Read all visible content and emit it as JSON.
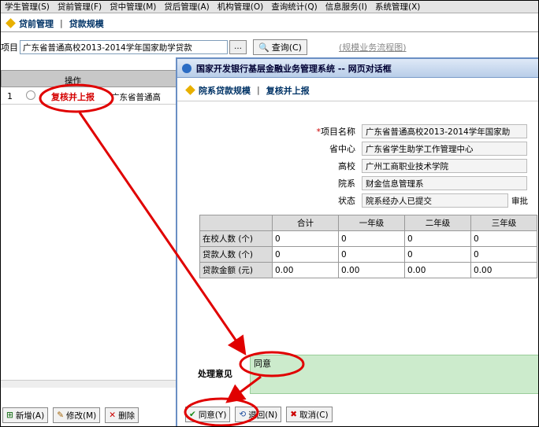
{
  "menu": [
    "学生管理(S)",
    "贷前管理(F)",
    "贷中管理(M)",
    "贷后管理(A)",
    "机构管理(O)",
    "查询统计(Q)",
    "信息服务(I)",
    "系统管理(X)"
  ],
  "tabs": {
    "first": "贷前管理",
    "second": "贷款规模"
  },
  "project": {
    "label": "项目",
    "value": "广东省普通高校2013-2014学年国家助学贷款",
    "query_label": "查询(C)",
    "flow_link": "(规模业务流程图)"
  },
  "grid": {
    "header_op": "操作",
    "row_num": "1",
    "row_action": "复核并上报",
    "row_name": "广东省普通高"
  },
  "bottom_toolbar": {
    "add": "新增(A)",
    "edit": "修改(M)",
    "delete": "删除"
  },
  "dialog": {
    "title": "国家开发银行基层金融业务管理系统 -- 网页对话框",
    "tab1": "院系贷款规模",
    "tab2": "复核并上报",
    "labels": {
      "project": "项目名称",
      "province": "省中心",
      "school": "高校",
      "faculty": "院系",
      "status": "状态"
    },
    "values": {
      "project": "广东省普通高校2013-2014学年国家助",
      "province": "广东省学生助学工作管理中心",
      "school": "广州工商职业技术学院",
      "faculty": "财金信息管理系",
      "status": "院系经办人已提交"
    },
    "audit_link": "审批",
    "table": {
      "headers": [
        "",
        "合计",
        "一年级",
        "二年级",
        "三年级"
      ],
      "rows": [
        {
          "label": "在校人数 (个)",
          "cells": [
            "0",
            "0",
            "0",
            "0"
          ]
        },
        {
          "label": "贷款人数 (个)",
          "cells": [
            "0",
            "0",
            "0",
            "0"
          ]
        },
        {
          "label": "贷款金额 (元)",
          "cells": [
            "0.00",
            "0.00",
            "0.00",
            "0.00"
          ]
        }
      ]
    },
    "opinion_label": "处理意见",
    "opinion_value": "同意",
    "buttons": {
      "agree": "同意(Y)",
      "back": "退回(N)",
      "cancel": "取消(C)"
    }
  },
  "colors": {
    "annotation": "#e00000",
    "opinion_bg": "#ccebcc",
    "dialog_border": "#6a8fc4"
  }
}
